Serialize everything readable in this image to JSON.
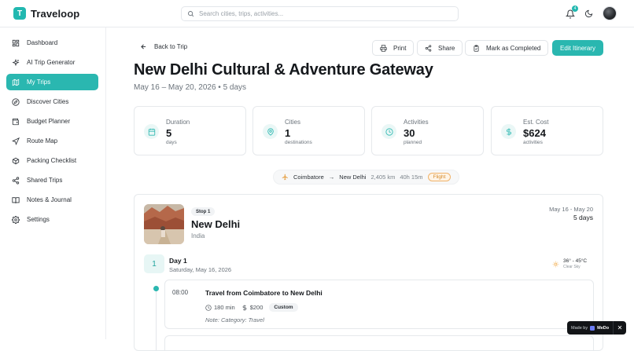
{
  "app": {
    "logo_letter": "T",
    "name": "Traveloop"
  },
  "search": {
    "placeholder": "Search cities, trips, activities..."
  },
  "notifications": {
    "count": "4"
  },
  "sidebar": {
    "items": [
      {
        "label": "Dashboard",
        "icon": "grid-icon"
      },
      {
        "label": "AI Trip Generator",
        "icon": "sparkles-icon"
      },
      {
        "label": "My Trips",
        "icon": "map-icon",
        "active": true
      },
      {
        "label": "Discover Cities",
        "icon": "compass-icon"
      },
      {
        "label": "Budget Planner",
        "icon": "wallet-icon"
      },
      {
        "label": "Route Map",
        "icon": "navigation-icon"
      },
      {
        "label": "Packing Checklist",
        "icon": "package-icon"
      },
      {
        "label": "Shared Trips",
        "icon": "share-icon"
      },
      {
        "label": "Notes & Journal",
        "icon": "book-icon"
      },
      {
        "label": "Settings",
        "icon": "gear-icon"
      }
    ]
  },
  "toolbar": {
    "back_label": "Back to Trip",
    "print_label": "Print",
    "share_label": "Share",
    "complete_label": "Mark as Completed",
    "edit_label": "Edit Itinerary"
  },
  "trip": {
    "title": "New Delhi Cultural & Adventure Gateway",
    "subtitle": "May 16 – May 20, 2026 • 5 days"
  },
  "stats": [
    {
      "label": "Duration",
      "value": "5",
      "sub": "days",
      "icon": "calendar-icon"
    },
    {
      "label": "Cities",
      "value": "1",
      "sub": "destinations",
      "icon": "pin-icon"
    },
    {
      "label": "Activities",
      "value": "30",
      "sub": "planned",
      "icon": "clock-icon"
    },
    {
      "label": "Est. Cost",
      "value": "$624",
      "sub": "activities",
      "icon": "dollar-icon"
    }
  ],
  "route": {
    "from": "Coimbatore",
    "to": "New Delhi",
    "distance": "2,405 km",
    "duration": "40h 15m",
    "mode": "Flight"
  },
  "stop": {
    "badge": "Stop 1",
    "city": "New Delhi",
    "country": "India",
    "dates": "May 16 - May 20",
    "days": "5 days"
  },
  "day": {
    "number": "1",
    "title": "Day 1",
    "date": "Saturday, May 16, 2026",
    "weather_temp": "36° - 45°C",
    "weather_desc": "Clear Sky"
  },
  "activity": {
    "time": "08:00",
    "title": "Travel from Coimbatore to New Delhi",
    "duration": "180 min",
    "cost": "$200",
    "tag": "Custom",
    "note": "Note: Category: Travel"
  },
  "footer": {
    "made_by": "Made by",
    "brand": "MeDo"
  },
  "colors": {
    "accent": "#2ab7b0",
    "flight_badge": "#d48a2c"
  }
}
